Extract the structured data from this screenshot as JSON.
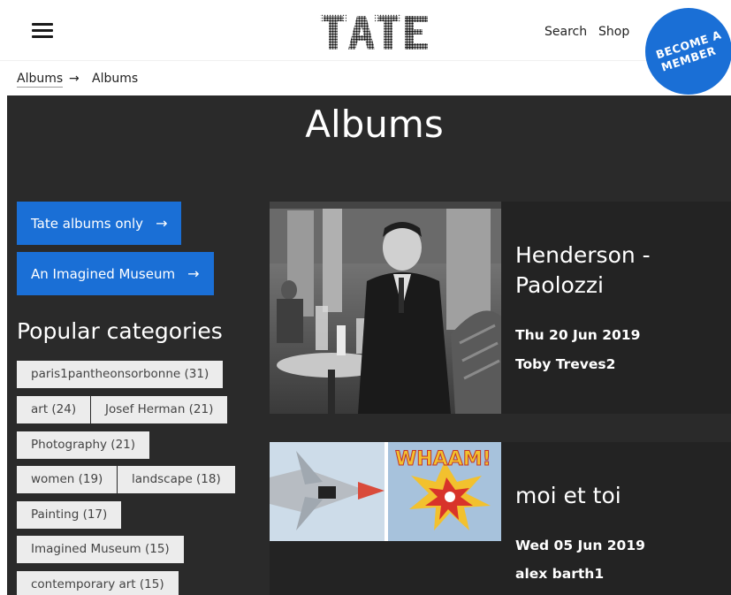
{
  "header": {
    "logo_text": "TATE",
    "nav": {
      "search": "Search",
      "shop": "Shop"
    },
    "member_line1": "BECOME A",
    "member_line2": "MEMBER"
  },
  "breadcrumb": {
    "item1": "Albums",
    "separator": "→",
    "item2": "Albums"
  },
  "page_title": "Albums",
  "filters": {
    "tate_albums": "Tate albums only",
    "imagined_museum": "An Imagined Museum"
  },
  "arrow": "→",
  "popular_title": "Popular categories",
  "categories": [
    "paris1pantheonsorbonne (31)",
    "art (24)",
    "Josef Herman (21)",
    "Photography (21)",
    "women (19)",
    "landscape (18)",
    "Painting (17)",
    "Imagined Museum (15)",
    "contemporary art (15)"
  ],
  "albums": [
    {
      "title": "Henderson - Paolozzi",
      "date": "Thu 20 Jun 2019",
      "author": "Toby Treves2"
    },
    {
      "title": "moi et toi",
      "date": "Wed 05 Jun 2019",
      "author": "alex barth1"
    }
  ],
  "colors": {
    "accent": "#1a6fd6",
    "panel": "#2a2a2a",
    "card": "#232323",
    "tag_bg": "#ececec"
  }
}
